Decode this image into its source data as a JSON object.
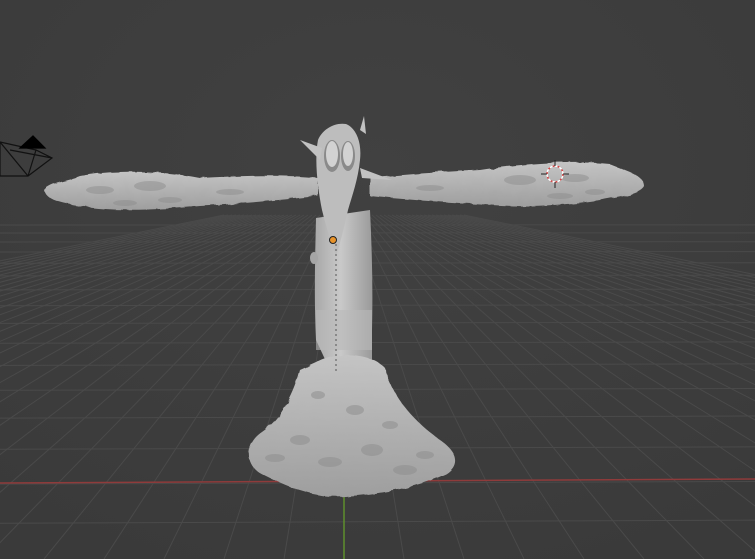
{
  "viewport": {
    "background_color": "#3d3d3d",
    "grid_color": "#4a4a4a",
    "x_axis_color": "#8f3b3b",
    "y_axis_color": "#5e8f2c",
    "mesh_color": "#b3b3b3",
    "origin_color": "#e8932a",
    "cursor_color": "#d64545"
  },
  "scene": {
    "object": "sculpted-t-pose-figure",
    "camera_icon": "camera-icon",
    "cursor_icon": "3d-cursor-icon",
    "origin_icon": "object-origin-icon"
  }
}
